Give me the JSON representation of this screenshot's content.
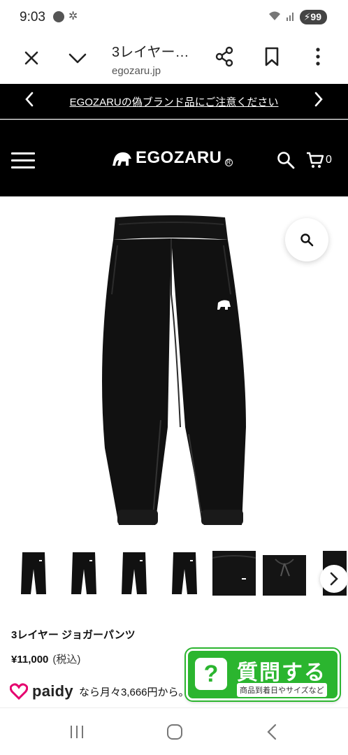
{
  "status_bar": {
    "time": "9:03",
    "battery": "99"
  },
  "tab_bar": {
    "title": "3レイヤー…",
    "domain": "egozaru.jp"
  },
  "announcement": {
    "message": "EGOZARUの偽ブランド品にご注意ください"
  },
  "site_header": {
    "logo_text": "EGOZARU",
    "logo_reg": "R",
    "cart_count": "0"
  },
  "product": {
    "name": "3レイヤー ジョガーパンツ",
    "price": "¥11,000",
    "tax_note": "(税込)",
    "paidy_logo": "paidy",
    "paidy_text": "なら月々3,666円から。"
  },
  "question_button": {
    "title": "質問する",
    "subtitle": "商品到着日やサイズなど",
    "badge": "?"
  },
  "thumbnails": [
    {
      "label": "pants-front"
    },
    {
      "label": "pants-front-2"
    },
    {
      "label": "pants-front-3"
    },
    {
      "label": "pants-front-4"
    },
    {
      "label": "pants-detail-waist"
    },
    {
      "label": "pants-detail-drawcord"
    },
    {
      "label": "pants-detail-partial"
    }
  ],
  "colors": {
    "brand_black": "#000000",
    "question_green": "#2bb52f",
    "paidy_pink": "#e5006e"
  }
}
